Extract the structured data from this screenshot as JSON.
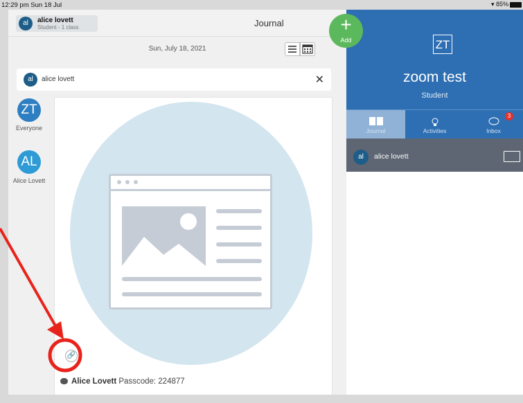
{
  "status": {
    "time": "12:29 pm  Sun 18 Jul",
    "battery": "85%"
  },
  "user_chip": {
    "initials": "al",
    "name": "alice lovett",
    "subtitle": "Student - 1 class"
  },
  "page_title": "Journal",
  "date": "Sun, July 18, 2021",
  "filter": {
    "initials": "al",
    "name": "alice lovett"
  },
  "sidebar": [
    {
      "initials": "ZT",
      "label": "Everyone",
      "color": "#2e7fc1"
    },
    {
      "initials": "AL",
      "label": "Alice Lovett",
      "color": "#2e9ad6"
    }
  ],
  "post": {
    "author": "Alice Lovett",
    "text": "Passcode: 224877"
  },
  "add_button": {
    "label": "Add"
  },
  "profile": {
    "initials": "ZT",
    "name": "zoom test",
    "role": "Student"
  },
  "tabs": [
    {
      "label": "Journal",
      "icon": "book-icon",
      "active": true
    },
    {
      "label": "Activities",
      "icon": "lightbulb-icon",
      "active": false
    },
    {
      "label": "Inbox",
      "icon": "chat-icon",
      "active": false,
      "badge": "3"
    }
  ],
  "journal_entry": {
    "initials": "al",
    "name": "alice lovett"
  },
  "colors": {
    "brand_blue": "#2e6fb3",
    "add_green": "#5cb85c",
    "annotation_red": "#e8231b",
    "badge_red": "#e0332e"
  }
}
